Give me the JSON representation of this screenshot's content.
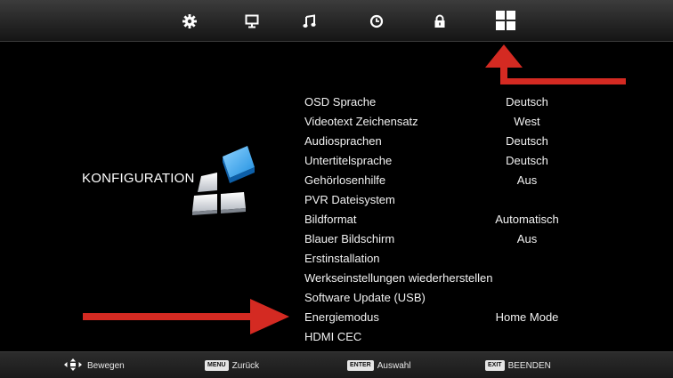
{
  "topbar": {
    "tabs": [
      {
        "icon": "picture-settings-icon"
      },
      {
        "icon": "monitor-icon"
      },
      {
        "icon": "music-note-icon"
      },
      {
        "icon": "clock-icon"
      },
      {
        "icon": "lock-icon"
      },
      {
        "icon": "setup-grid-icon",
        "selected": true
      }
    ]
  },
  "section": {
    "title": "KONFIGURATION"
  },
  "menu": {
    "items": [
      {
        "label": "OSD Sprache",
        "value": "Deutsch"
      },
      {
        "label": "Videotext Zeichensatz",
        "value": "West"
      },
      {
        "label": "Audiosprachen",
        "value": "Deutsch"
      },
      {
        "label": "Untertitelsprache",
        "value": "Deutsch"
      },
      {
        "label": "Gehörlosenhilfe",
        "value": "Aus"
      },
      {
        "label": "PVR Dateisystem",
        "value": ""
      },
      {
        "label": "Bildformat",
        "value": "Automatisch"
      },
      {
        "label": "Blauer Bildschirm",
        "value": "Aus"
      },
      {
        "label": "Erstinstallation",
        "value": ""
      },
      {
        "label": "Werkseinstellungen wiederherstellen",
        "value": ""
      },
      {
        "label": "Software Update (USB)",
        "value": ""
      },
      {
        "label": "Energiemodus",
        "value": "Home Mode"
      },
      {
        "label": "HDMI CEC",
        "value": ""
      }
    ]
  },
  "hints": {
    "move": {
      "label": "Bewegen"
    },
    "back": {
      "key": "MENU",
      "label": "Zurück"
    },
    "select": {
      "key": "ENTER",
      "label": "Auswahl"
    },
    "exit": {
      "key": "EXIT",
      "label": "BEENDEN"
    }
  },
  "colors": {
    "accent_arrow": "#d42a22",
    "background": "#000000",
    "text": "#f2f2f2"
  }
}
